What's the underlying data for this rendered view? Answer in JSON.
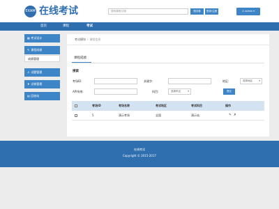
{
  "header": {
    "logo_mark": "EXAM",
    "site_title": "在线考试",
    "search_placeholder": "搜索课程/试卷",
    "search_button": "搜试卷",
    "register_button": "登录/注册",
    "user_label": "admin ▾"
  },
  "nav": {
    "home": "首页",
    "course": "课程",
    "exam": "考试"
  },
  "sidebar": {
    "items": [
      {
        "label": "考试设计",
        "icon": "grid-icon"
      },
      {
        "label": "课程成绩",
        "icon": "edit-icon"
      },
      {
        "label": "成绩管理",
        "sub": true
      },
      {
        "label": "试题管理",
        "icon": "user-icon"
      },
      {
        "label": "试卷管理",
        "icon": "folder-icon"
      },
      {
        "label": "回收站",
        "icon": "trash-icon"
      }
    ]
  },
  "breadcrumb": {
    "root": "考试模块",
    "sep": "/",
    "current": "课程信息"
  },
  "tab": {
    "title": "课程成绩"
  },
  "search": {
    "section_label": "搜索",
    "exam_id_label": "考场ID:",
    "keyword_label": "关键字:",
    "region_label": "地区:",
    "region_value": "选择地区",
    "api_id_label": "API系统:",
    "subject_label": "科目:",
    "subject_value": "选择科目",
    "query_button": "提交"
  },
  "table": {
    "headers": [
      "考场ID",
      "考场名称",
      "考试地区",
      "考试科目",
      "操作"
    ],
    "rows": [
      {
        "id": "5",
        "name": "演示考场",
        "region": "全国",
        "subject": "演示站"
      }
    ]
  },
  "footer": {
    "line1": "在线考试",
    "line2": "Copyright © 2015-2017"
  },
  "colors": {
    "primary": "#2f6fb0",
    "accent": "#3d85c6",
    "table_header": "#d4e3f2"
  }
}
